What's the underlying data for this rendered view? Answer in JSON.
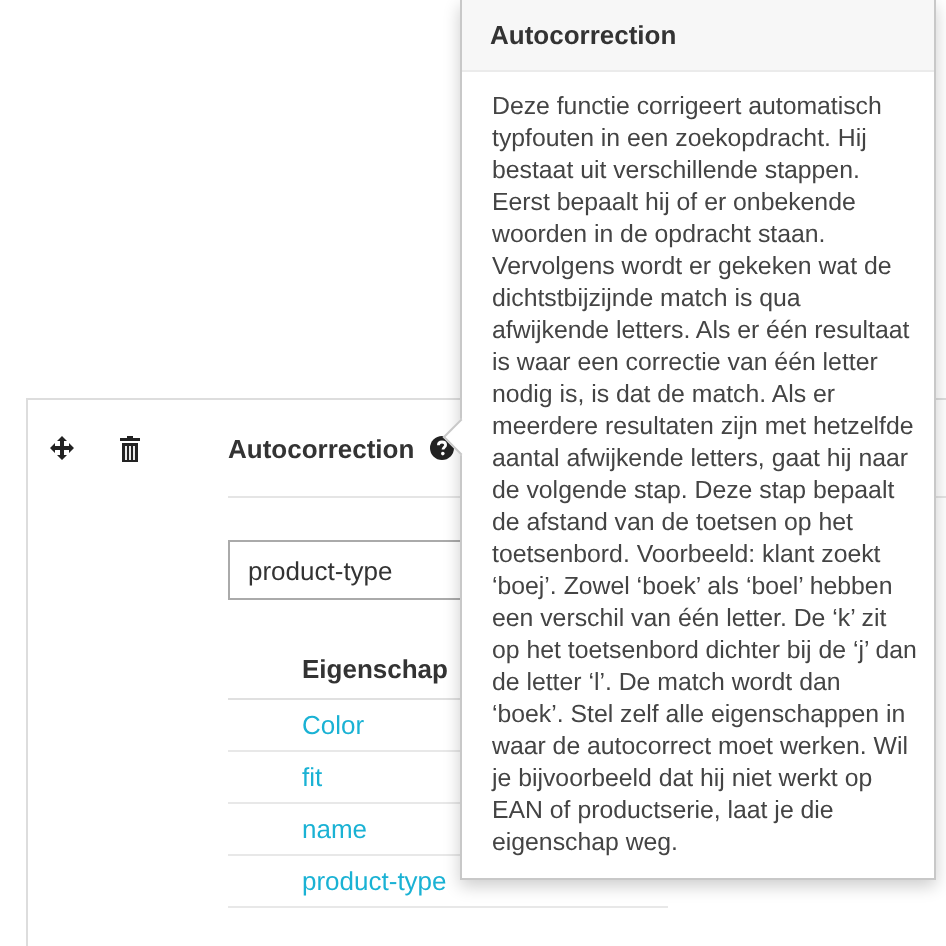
{
  "panel": {
    "title": "Autocorrection",
    "field": {
      "value": "product-type"
    },
    "table": {
      "columns": [
        "Eigenschap"
      ],
      "rows": [
        "Color",
        "fit",
        "name",
        "product-type"
      ]
    }
  },
  "popover": {
    "title": "Autocorrection",
    "body": "Deze functie corrigeert automatisch typfouten in een zoekopdracht. Hij bestaat uit verschillende stappen. Eerst bepaalt hij of er onbekende woorden in de opdracht staan. Vervolgens wordt er gekeken wat de dichtstbijzijnde match is qua afwijkende letters. Als er één resultaat is waar een correctie van één letter nodig is, is dat de match. Als er meerdere resultaten zijn met hetzelfde aantal afwijkende letters, gaat hij naar de volgende stap. Deze stap bepaalt de afstand van de toetsen op het toetsenbord. Voorbeeld: klant zoekt ‘boej’. Zowel ‘boek’ als ‘boel’ hebben een verschil van één letter. De ‘k’ zit op het toetsenbord dichter bij de ‘j’ dan de letter ‘l’. De match wordt dan ‘boek’. Stel zelf alle eigenschappen in waar de autocorrect moet werken. Wil je bijvoorbeeld dat hij niet werkt op EAN of productserie, laat je die eigenschap weg."
  }
}
